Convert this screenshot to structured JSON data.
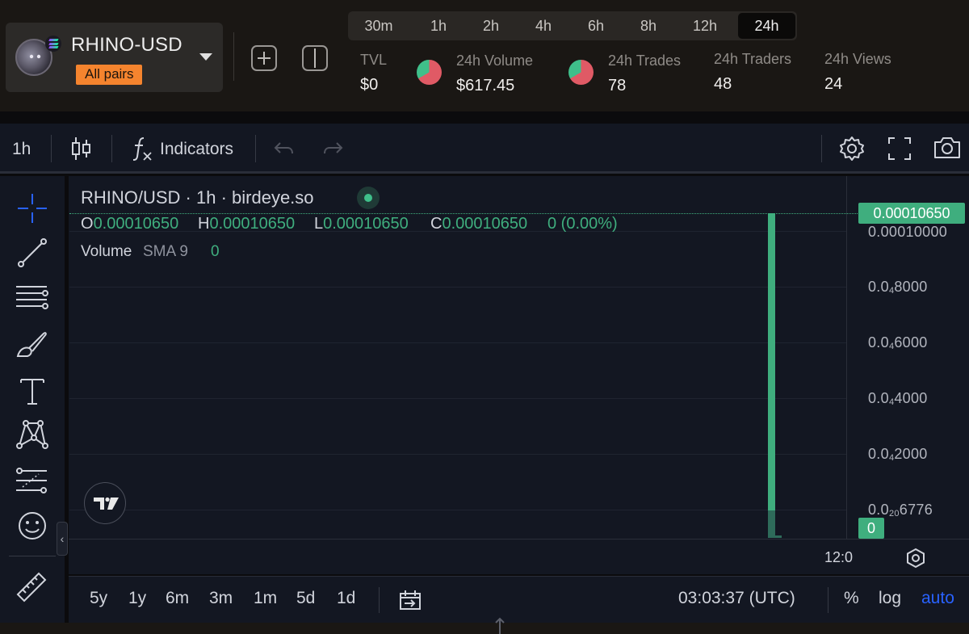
{
  "header": {
    "pair_name": "RHINO-USD",
    "pair_tag": "All pairs",
    "timeframes": [
      "30m",
      "1h",
      "2h",
      "4h",
      "6h",
      "8h",
      "12h",
      "24h"
    ],
    "active_timeframe": "24h",
    "stats": {
      "tvl_label": "TVL",
      "tvl_value": "$0",
      "volume_label": "24h Volume",
      "volume_value": "$617.45",
      "trades_label": "24h Trades",
      "trades_value": "78",
      "traders_label": "24h Traders",
      "traders_value": "48",
      "views_label": "24h Views",
      "views_value": "24"
    },
    "colors": {
      "tag_bg": "#f5842e",
      "pie_sell": "#e05a65",
      "pie_buy": "#3fbf8a"
    }
  },
  "toolbar": {
    "interval": "1h",
    "indicators_label": "Indicators",
    "icons": [
      "candles-icon",
      "fx-icon",
      "undo-icon",
      "redo-icon",
      "settings-icon",
      "fullscreen-icon",
      "camera-icon"
    ]
  },
  "left_tools": [
    "crosshair-icon",
    "trend-line-icon",
    "fib-lines-icon",
    "brush-icon",
    "text-icon",
    "pattern-icon",
    "forecast-icon",
    "emoji-icon",
    "ruler-icon"
  ],
  "chart": {
    "legend_title": "RHINO/USD · 1h · birdeye.so",
    "ohlc": {
      "o_label": "O",
      "o_value": "0.00010650",
      "h_label": "H",
      "h_value": "0.00010650",
      "l_label": "L",
      "l_value": "0.00010650",
      "c_label": "C",
      "c_value": "0.00010650",
      "change": "0 (0.00%)"
    },
    "volume_label": "Volume",
    "volume_sma": "SMA 9",
    "volume_value": "0",
    "current_price": "0.00010650",
    "volume_badge": "0",
    "price_ticks": [
      "0.00010000",
      "0.0",
      "0.0",
      "0.0",
      "0.0",
      "0.0"
    ],
    "price_ticks_full": [
      {
        "lead": "0.00010000",
        "sub": "",
        "tail": ""
      },
      {
        "lead": "0.0",
        "sub": "4",
        "tail": "8000"
      },
      {
        "lead": "0.0",
        "sub": "4",
        "tail": "6000"
      },
      {
        "lead": "0.0",
        "sub": "4",
        "tail": "4000"
      },
      {
        "lead": "0.0",
        "sub": "4",
        "tail": "2000"
      },
      {
        "lead": "0.0",
        "sub": "20",
        "tail": "6776"
      }
    ],
    "time_label": "12:0",
    "accent_up": "#3fae7e"
  },
  "bottom": {
    "ranges": [
      "5y",
      "1y",
      "6m",
      "3m",
      "1m",
      "5d",
      "1d"
    ],
    "clock": "03:03:37 (UTC)",
    "percent_label": "%",
    "log_label": "log",
    "auto_label": "auto"
  }
}
